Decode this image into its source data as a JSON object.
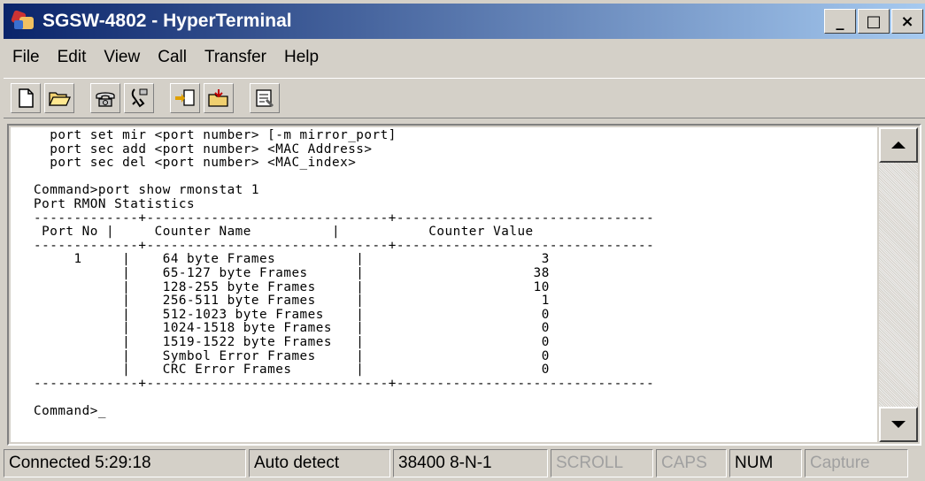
{
  "window": {
    "title": "SGSW-4802 - HyperTerminal"
  },
  "title_controls": {
    "minimize": "_",
    "maximize": "□",
    "close": "×"
  },
  "menu": [
    "File",
    "Edit",
    "View",
    "Call",
    "Transfer",
    "Help"
  ],
  "toolbar_icons": [
    "new-document-icon",
    "open-folder-icon",
    "call-phone-icon",
    "disconnect-icon",
    "send-file-icon",
    "receive-file-icon",
    "properties-icon"
  ],
  "terminal": {
    "lines": [
      "  port set mir <port number> [-m mirror_port]",
      "  port sec add <port number> <MAC Address>",
      "  port sec del <port number> <MAC_index>",
      "",
      "Command>port show rmonstat 1",
      "Port RMON Statistics",
      "-------------+------------------------------+--------------------------------",
      " Port No |     Counter Name          |           Counter Value",
      "-------------+------------------------------+--------------------------------",
      "     1     |    64 byte Frames          |                      3",
      "           |    65-127 byte Frames      |                     38",
      "           |    128-255 byte Frames     |                     10",
      "           |    256-511 byte Frames     |                      1",
      "           |    512-1023 byte Frames    |                      0",
      "           |    1024-1518 byte Frames   |                      0",
      "           |    1519-1522 byte Frames   |                      0",
      "           |    Symbol Error Frames     |                      0",
      "           |    CRC Error Frames        |                      0",
      "-------------+------------------------------+--------------------------------",
      "",
      "Command>_"
    ]
  },
  "status": {
    "connected": "Connected 5:29:18",
    "detect": "Auto detect",
    "baud": "38400 8-N-1",
    "scroll": "SCROLL",
    "caps": "CAPS",
    "num": "NUM",
    "capture": "Capture"
  }
}
